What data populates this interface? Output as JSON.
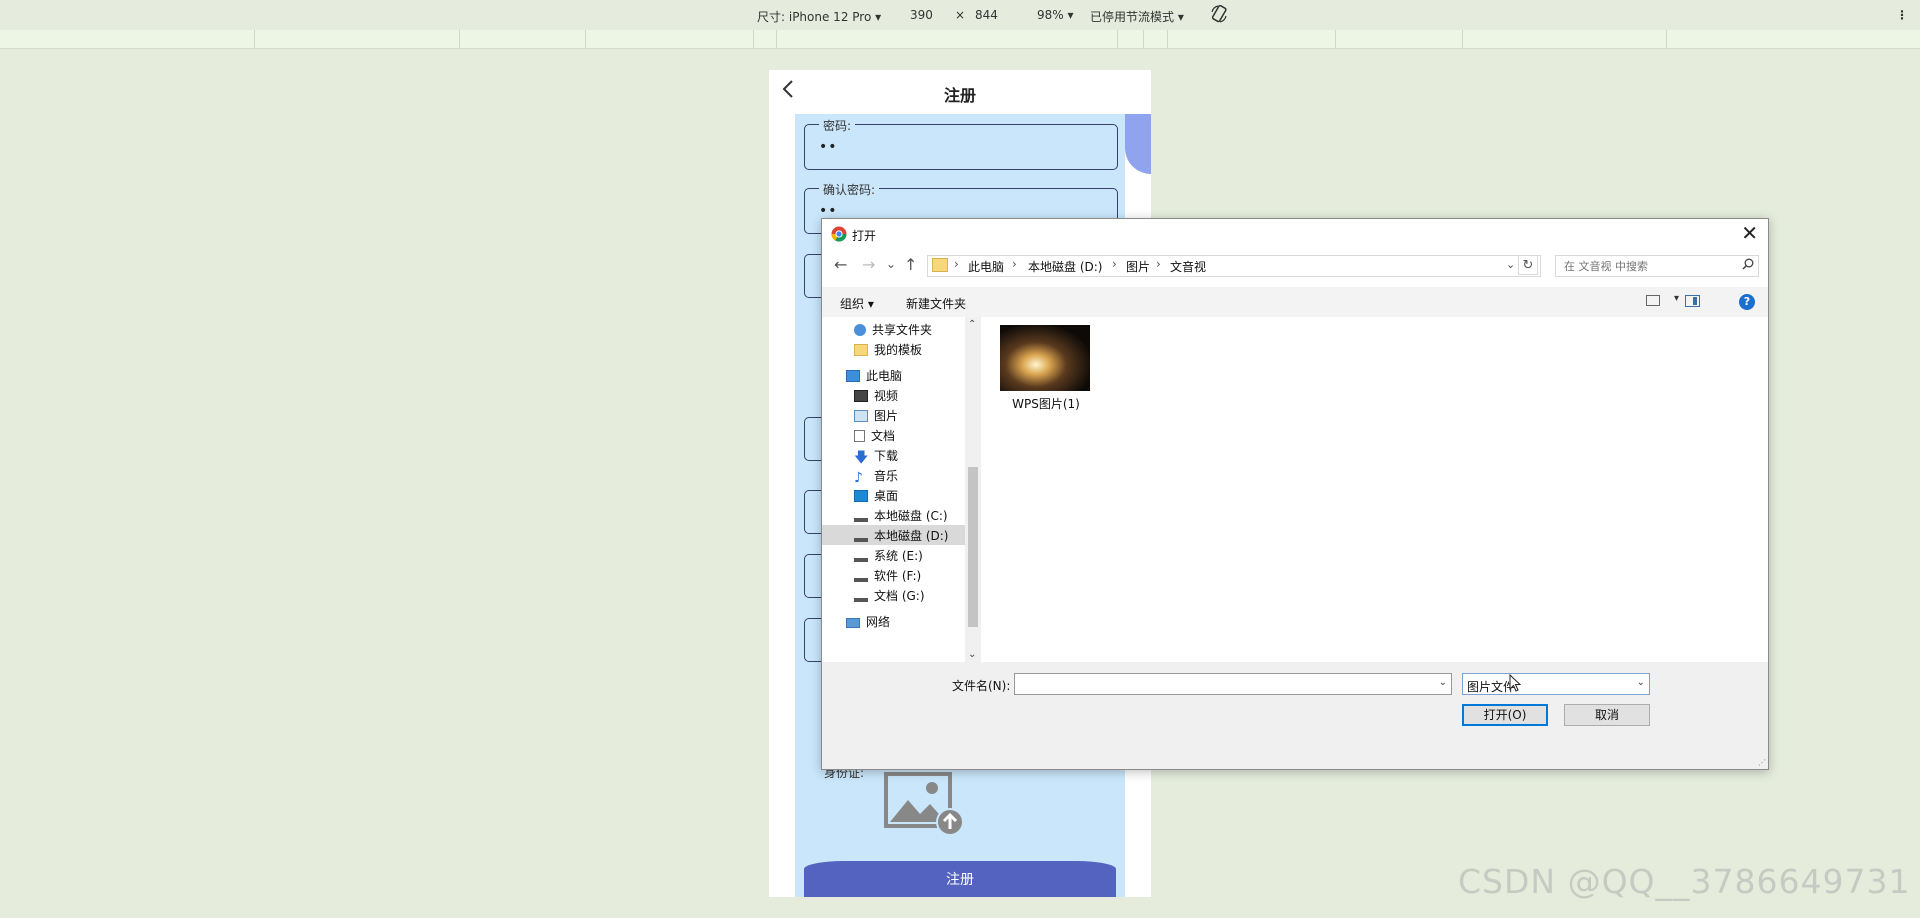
{
  "devtools": {
    "device_label": "尺寸: iPhone 12 Pro ▾",
    "width": "390",
    "times": "×",
    "height": "844",
    "zoom": "98% ▾",
    "throttle": "已停用节流模式 ▾",
    "rotate_icon": "rotate-icon",
    "more": "⋮"
  },
  "phone": {
    "back_icon": "chevron-left-icon",
    "title": "注册",
    "fields": [
      {
        "label": "密码:",
        "value": "••"
      },
      {
        "label": "确认密码:",
        "value": "••"
      }
    ],
    "id_label": "身份证:",
    "upload_icon": "image-upload-icon",
    "register_button": "注册"
  },
  "dialog": {
    "title": "打开",
    "app_icon": "chrome-icon",
    "close": "✕",
    "nav": {
      "back": "←",
      "forward": "→",
      "recent": "⌄",
      "up": "↑"
    },
    "breadcrumb": [
      "此电脑",
      "本地磁盘 (D:)",
      "图片",
      "文音视"
    ],
    "refresh": "↻",
    "search_placeholder": "在 文音视 中搜索",
    "organize": "组织 ▾",
    "new_folder": "新建文件夹",
    "help": "?",
    "nav_items": [
      {
        "label": "共享文件夹",
        "icon": "shared-folder-icon"
      },
      {
        "label": "我的模板",
        "icon": "folder-icon"
      },
      {
        "label": "此电脑",
        "icon": "computer-icon"
      },
      {
        "label": "视频",
        "icon": "video-icon"
      },
      {
        "label": "图片",
        "icon": "pictures-icon"
      },
      {
        "label": "文档",
        "icon": "documents-icon"
      },
      {
        "label": "下载",
        "icon": "download-icon"
      },
      {
        "label": "音乐",
        "icon": "music-icon"
      },
      {
        "label": "桌面",
        "icon": "desktop-icon"
      },
      {
        "label": "本地磁盘 (C:)",
        "icon": "drive-icon"
      },
      {
        "label": "本地磁盘 (D:)",
        "icon": "drive-icon",
        "selected": true
      },
      {
        "label": "系统 (E:)",
        "icon": "drive-icon"
      },
      {
        "label": "软件 (F:)",
        "icon": "drive-icon"
      },
      {
        "label": "文档 (G:)",
        "icon": "drive-icon"
      },
      {
        "label": "网络",
        "icon": "network-icon"
      }
    ],
    "files": [
      {
        "name": "WPS图片(1)",
        "icon": "image-thumbnail"
      }
    ],
    "filename_label": "文件名(N):",
    "filename_value": "",
    "filetype": "图片文件",
    "open_button": "打开(O)",
    "cancel_button": "取消"
  },
  "watermark": "CSDN @QQ__3786649731"
}
